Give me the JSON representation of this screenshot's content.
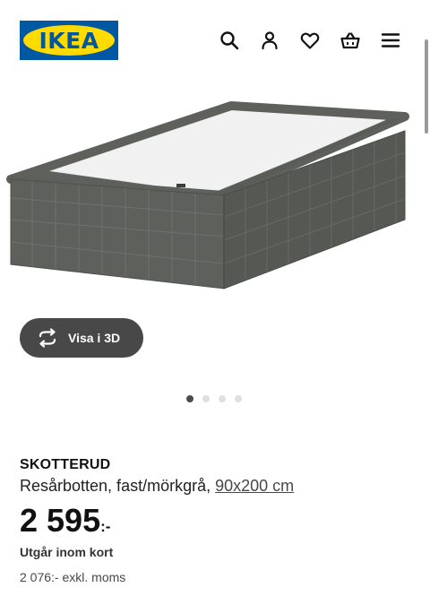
{
  "header": {
    "logo_text": "IKEA",
    "icons": [
      "search-icon",
      "user-icon",
      "heart-icon",
      "basket-icon",
      "menu-icon"
    ]
  },
  "hero": {
    "image_alt": "SKOTTERUD"
  },
  "view3d": {
    "label": "Visa i 3D",
    "icon": "rotate-icon"
  },
  "carousel": {
    "count": 4,
    "active_index": 0
  },
  "product": {
    "name": "SKOTTERUD",
    "description": "Resårbotten, fast/mörkgrå, ",
    "size": "90x200 cm",
    "price_amount": "2 595",
    "price_suffix": ":-",
    "availability": "Utgår inom kort",
    "price_excl": "2 076:- exkl. moms"
  },
  "colors": {
    "brand_blue": "#0058a3",
    "brand_yellow": "#ffdb00",
    "button_dark": "#484848",
    "fabric": "#5e605c"
  }
}
